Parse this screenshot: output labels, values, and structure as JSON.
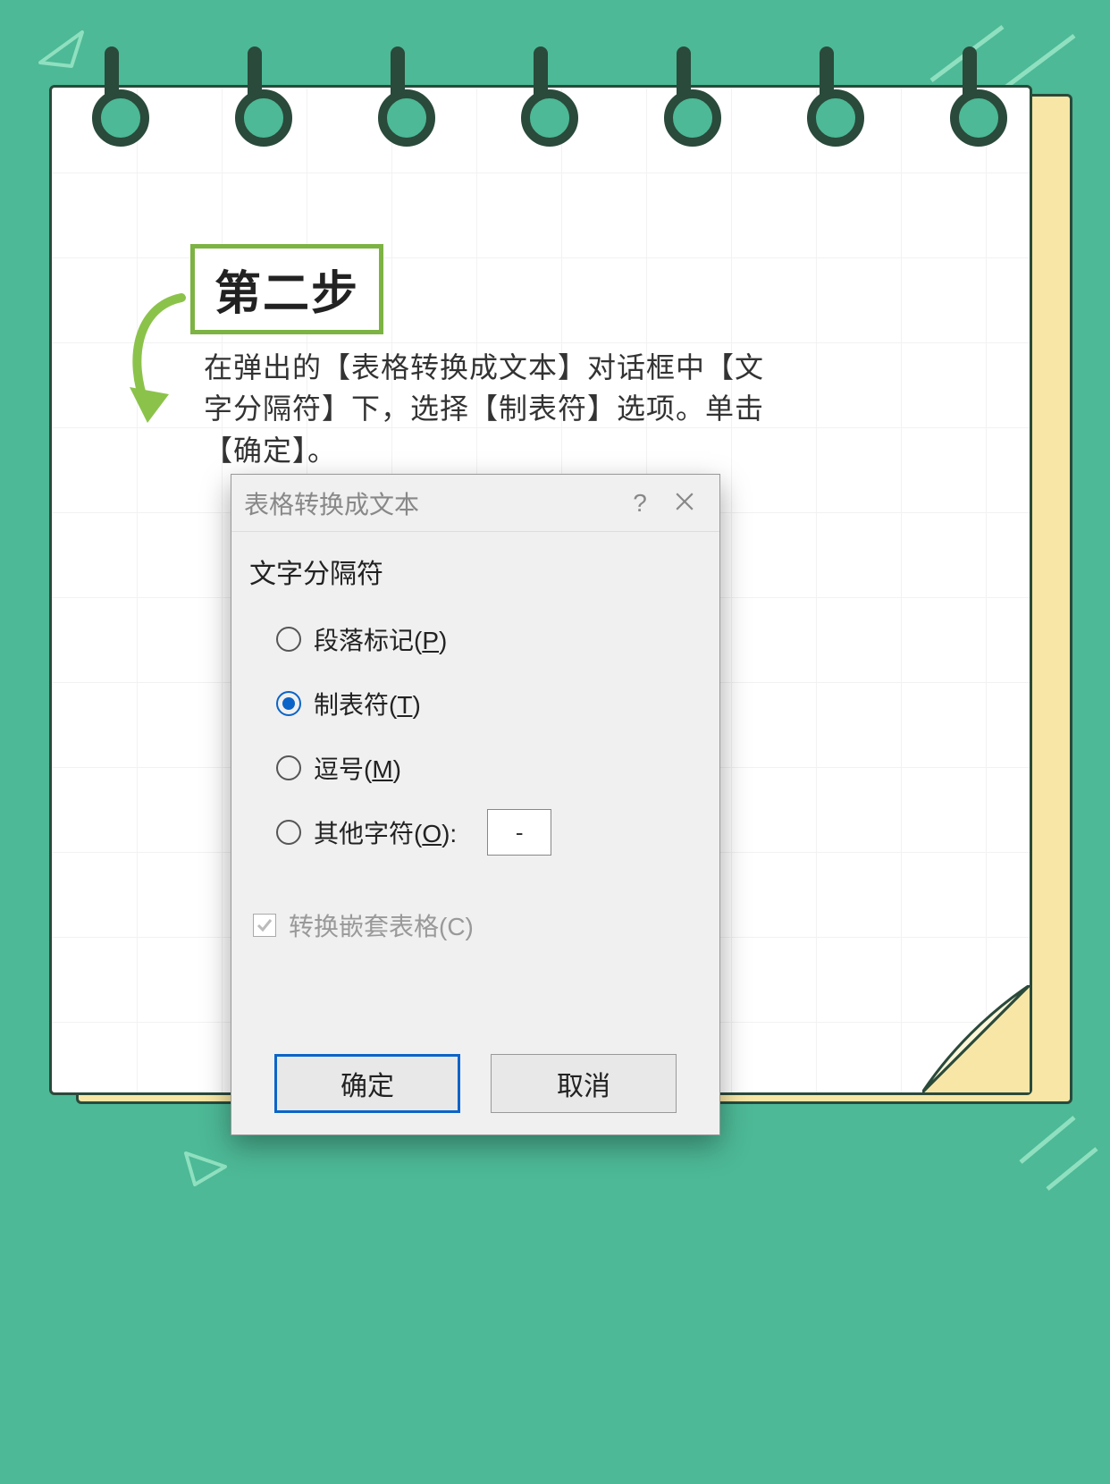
{
  "step": {
    "title": "第二步",
    "instruction": "在弹出的【表格转换成文本】对话框中【文字分隔符】下，选择【制表符】选项。单击【确定】。"
  },
  "dialog": {
    "title": "表格转换成文本",
    "help_symbol": "?",
    "group_label": "文字分隔符",
    "options": {
      "paragraph": {
        "label": "段落标记(",
        "hotkey": "P",
        "suffix": ")"
      },
      "tab": {
        "label": "制表符(",
        "hotkey": "T",
        "suffix": ")"
      },
      "comma": {
        "label": "逗号(",
        "hotkey": "M",
        "suffix": ")"
      },
      "other": {
        "label": "其他字符(",
        "hotkey": "O",
        "suffix": "):",
        "value": "-"
      }
    },
    "selected": "tab",
    "checkbox": {
      "label": "转换嵌套表格(C)",
      "checked": true,
      "disabled": true
    },
    "buttons": {
      "ok": "确定",
      "cancel": "取消"
    }
  }
}
